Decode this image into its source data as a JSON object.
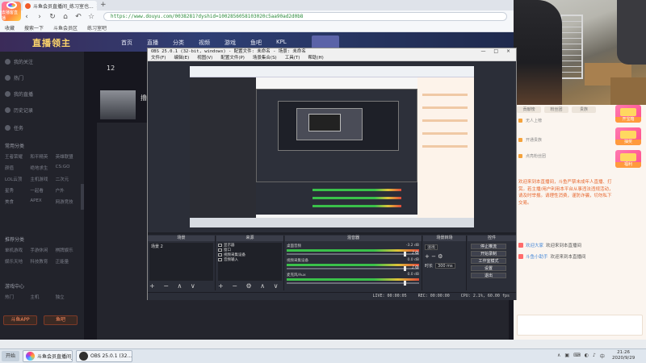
{
  "browser": {
    "logo_label": "去播客直播",
    "tab_title": "斗鱼会员直播间_练习室也...",
    "tab_close": "×",
    "new_tab": "+",
    "nav": [
      "‹",
      "›",
      "↻",
      "⌂",
      "↶",
      "☆"
    ],
    "url": "https://www.douyu.com/0038281?dyshid=1002856058103020c5aa90ad2d0b8",
    "bookmarks": [
      "收藏",
      "搜索一下",
      "斗鱼会员区",
      "练习室吧"
    ]
  },
  "site": {
    "logo": "直播领主",
    "nav": [
      "首页",
      "直播",
      "分类",
      "视频",
      "游戏",
      "鱼吧",
      "KPL"
    ]
  },
  "sidebar": {
    "items": [
      "我的关注",
      "热门",
      "我的直播",
      "历史记录",
      "任务"
    ],
    "heading_1": "常用分类",
    "grid_1": [
      "王者荣耀",
      "和平精英",
      "英雄联盟",
      "颜值",
      "绝地求生",
      "CS:GO",
      "LOL云顶",
      "主机游戏",
      "二次元",
      "星秀",
      "一起看",
      "户外",
      "美食",
      "APEX",
      "网游竞技"
    ],
    "heading_2": "推荐分类",
    "grid_2": [
      "单机游戏",
      "手游休闲",
      "棋牌娱乐",
      "娱乐天地",
      "科技教育",
      "正能量"
    ],
    "heading_3": "游戏中心",
    "grid_3": [
      "热门",
      "主机",
      "独立"
    ],
    "btn_1": "斗鱼APP",
    "btn_2": "鱼吧"
  },
  "room": {
    "viewer_count": "12",
    "title_char": "撸"
  },
  "chat": {
    "tabs": [
      "贡献榜",
      "粉丝团",
      "贵族"
    ],
    "rows": [
      "无人上榜",
      "开通贵族",
      "点亮粉丝团"
    ],
    "gift_labels": [
      "开宝箱",
      "抽奖",
      "福利"
    ],
    "notice": "欢迎来到本直播间，斗鱼严禁未成年人直播、打赏。若主播/用户利用本平台从事违法违规活动，请及时举报。请理性消费，谨防诈骗，切勿私下交易。",
    "messages": [
      {
        "name": "欢迎大家",
        "text": "欢迎来到本直播间"
      },
      {
        "name": "斗鱼小助手",
        "text": "欢迎来到本直播间"
      }
    ]
  },
  "obs": {
    "title": "OBS 25.0.1 (32-bit, windows) - 配置文件: 未命名 - 场景: 未命名",
    "win_buttons": "— □ ×",
    "menu": [
      "文件(F)",
      "编辑(E)",
      "视图(V)",
      "配置文件(P)",
      "场景集合(S)",
      "工具(T)",
      "帮助(H)"
    ],
    "docks": {
      "scenes": {
        "title": "场景",
        "items": [
          "场景 2"
        ]
      },
      "sources": {
        "title": "来源",
        "items": [
          "显示器",
          "窗口",
          "视频采集设备",
          "音频输入"
        ]
      },
      "mixer": {
        "title": "混音器",
        "channels": [
          {
            "name": "桌面音频",
            "db": "-3.2 dB"
          },
          {
            "name": "视频采集设备",
            "db": "0.0 dB"
          },
          {
            "name": "麦克风/Aux",
            "db": "0.0 dB"
          }
        ]
      },
      "transitions": {
        "title": "场景转场",
        "type": "淡出",
        "duration_label": "时长",
        "duration": "300 ms"
      },
      "controls": {
        "title": "控件",
        "buttons": [
          "停止推流",
          "开始录制",
          "工作室模式",
          "设置",
          "退出"
        ]
      }
    },
    "dock_foot": "+ − ∧ ∨",
    "dock_foot_src": "+ − ⚙ ∧ ∨",
    "status": [
      "LIVE: 00:00:05",
      "REC: 00:00:00",
      "CPU: 2.1%, 60.00 fps"
    ]
  },
  "taskbar": {
    "start": "开始",
    "apps": [
      {
        "label": "斗鱼会员直播间_练...",
        "color": "#ff6a3d"
      },
      {
        "label": "OBS 25.0.1 (32...",
        "color": "#303030"
      }
    ],
    "tray": [
      "∧",
      "▣",
      "⌨",
      "◐",
      "♪",
      "中"
    ],
    "time": "21:26",
    "date": "2020/9/29"
  },
  "colors": {
    "accent": "#ff6a3d",
    "obs_bg": "#2b2e38",
    "meter_green": "#3ac14a"
  }
}
